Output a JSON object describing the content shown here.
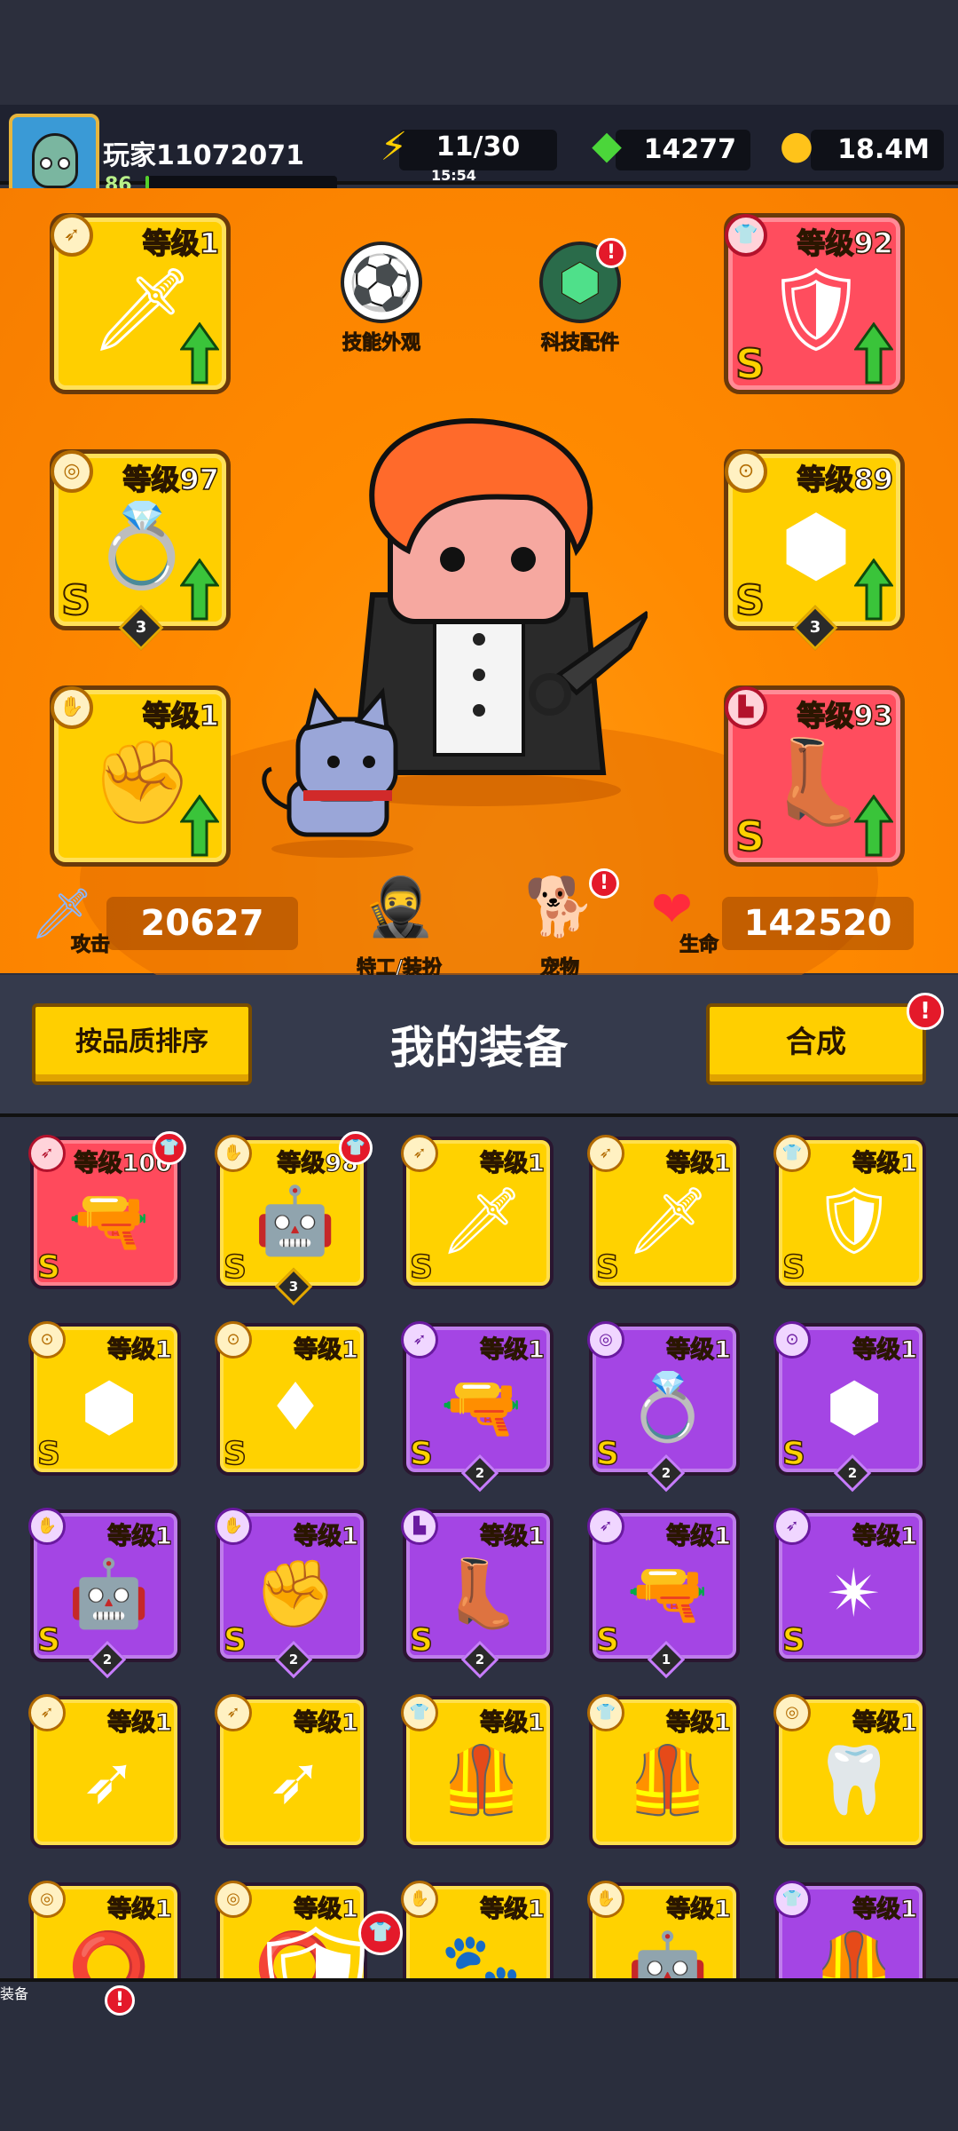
{
  "player": {
    "name": "玩家11072071",
    "level": "86",
    "xp_progress": 0.02
  },
  "resources": {
    "energy": "11/30",
    "energy_timer": "15:54",
    "gems": "14277",
    "gold": "18.4M"
  },
  "equipped": {
    "left": [
      {
        "level": "等级1",
        "icon": "kunai-icon",
        "color": "yellow",
        "grade": "",
        "stars": "",
        "upgrade": true
      },
      {
        "level": "等级97",
        "icon": "ring-icon",
        "color": "yellow",
        "grade": "S",
        "stars": "3",
        "upgrade": true
      },
      {
        "level": "等级1",
        "icon": "glove-icon",
        "color": "yellow",
        "grade": "",
        "stars": "",
        "upgrade": true
      }
    ],
    "right": [
      {
        "level": "等级92",
        "icon": "armor-icon",
        "color": "red",
        "grade": "S",
        "stars": "",
        "upgrade": true
      },
      {
        "level": "等级89",
        "icon": "belt-icon",
        "color": "yellow",
        "grade": "S",
        "stars": "3",
        "upgrade": true
      },
      {
        "level": "等级93",
        "icon": "boots-icon",
        "color": "red",
        "grade": "S",
        "stars": "",
        "upgrade": true
      }
    ]
  },
  "mid_menu": {
    "skill_skin": "技能外观",
    "tech_parts": "科技配件",
    "agent_outfit": "特工/装扮",
    "pet": "宠物"
  },
  "stats": {
    "attack_label": "攻击",
    "attack": "20627",
    "hp_label": "生命",
    "hp": "142520"
  },
  "inventory_bar": {
    "sort_button": "按品质排序",
    "title": "我的装备",
    "merge_button": "合成"
  },
  "inventory": [
    {
      "level": "等级100",
      "icon": "blaster-icon",
      "color": "red",
      "grade": "S",
      "stars": "",
      "new": true
    },
    {
      "level": "等级98",
      "icon": "gauntlet-icon",
      "color": "yellow",
      "grade": "S",
      "stars": "3",
      "new": true
    },
    {
      "level": "等级1",
      "icon": "sword-icon",
      "color": "yellow",
      "grade": "S",
      "stars": "",
      "new": false
    },
    {
      "level": "等级1",
      "icon": "sword-icon",
      "color": "yellow",
      "grade": "S",
      "stars": "",
      "new": false
    },
    {
      "level": "等级1",
      "icon": "armor-icon",
      "color": "yellow",
      "grade": "S",
      "stars": "",
      "new": false
    },
    {
      "level": "等级1",
      "icon": "belt-icon",
      "color": "yellow",
      "grade": "S",
      "stars": "",
      "new": false
    },
    {
      "level": "等级1",
      "icon": "belt-red-icon",
      "color": "yellow",
      "grade": "S",
      "stars": "",
      "new": false
    },
    {
      "level": "等级1",
      "icon": "blaster-icon",
      "color": "purple",
      "grade": "S",
      "stars": "2",
      "new": false
    },
    {
      "level": "等级1",
      "icon": "ring-icon",
      "color": "purple",
      "grade": "S",
      "stars": "2",
      "new": false
    },
    {
      "level": "等级1",
      "icon": "belt-icon",
      "color": "purple",
      "grade": "S",
      "stars": "2",
      "new": false
    },
    {
      "level": "等级1",
      "icon": "gauntlet-icon",
      "color": "purple",
      "grade": "S",
      "stars": "2",
      "new": false
    },
    {
      "level": "等级1",
      "icon": "gauntlet-dark-icon",
      "color": "purple",
      "grade": "S",
      "stars": "2",
      "new": false
    },
    {
      "level": "等级1",
      "icon": "boots-icon",
      "color": "purple",
      "grade": "S",
      "stars": "2",
      "new": false
    },
    {
      "level": "等级1",
      "icon": "blaster-icon",
      "color": "purple",
      "grade": "S",
      "stars": "1",
      "new": false
    },
    {
      "level": "等级1",
      "icon": "shuriken-icon",
      "color": "purple",
      "grade": "S",
      "stars": "",
      "new": false
    },
    {
      "level": "等级1",
      "icon": "kunai-icon",
      "color": "yellow",
      "grade": "",
      "stars": "",
      "new": false
    },
    {
      "level": "等级1",
      "icon": "kunai-icon",
      "color": "yellow",
      "grade": "",
      "stars": "",
      "new": false
    },
    {
      "level": "等级1",
      "icon": "vest-icon",
      "color": "yellow",
      "grade": "",
      "stars": "",
      "new": false
    },
    {
      "level": "等级1",
      "icon": "vest-icon",
      "color": "yellow",
      "grade": "",
      "stars": "",
      "new": false
    },
    {
      "level": "等级1",
      "icon": "fang-necklace-icon",
      "color": "yellow",
      "grade": "",
      "stars": "",
      "new": false
    },
    {
      "level": "等级1",
      "icon": "ring-dark-icon",
      "color": "yellow",
      "grade": "",
      "stars": "",
      "new": false
    },
    {
      "level": "等级1",
      "icon": "ring-dark-icon",
      "color": "yellow",
      "grade": "",
      "stars": "",
      "new": false
    },
    {
      "level": "等级1",
      "icon": "claw-glove-icon",
      "color": "yellow",
      "grade": "",
      "stars": "",
      "new": false
    },
    {
      "level": "等级1",
      "icon": "gauntlet-icon",
      "color": "yellow",
      "grade": "",
      "stars": "",
      "new": false
    },
    {
      "level": "等级1",
      "icon": "vest-icon",
      "color": "purple",
      "grade": "",
      "stars": "",
      "new": false
    }
  ],
  "nav": {
    "active_label": "装备",
    "tabs": [
      "shop-icon",
      "equipment-icon",
      "star-battle-icon",
      "planet-icon",
      "dna-capsule-icon"
    ]
  },
  "colors": {
    "stage": "#ff8a00",
    "yellow_frame": "#ffd200",
    "red_frame": "#ff4a5c",
    "purple_frame": "#a445e4",
    "badge_red": "#e4192a"
  }
}
